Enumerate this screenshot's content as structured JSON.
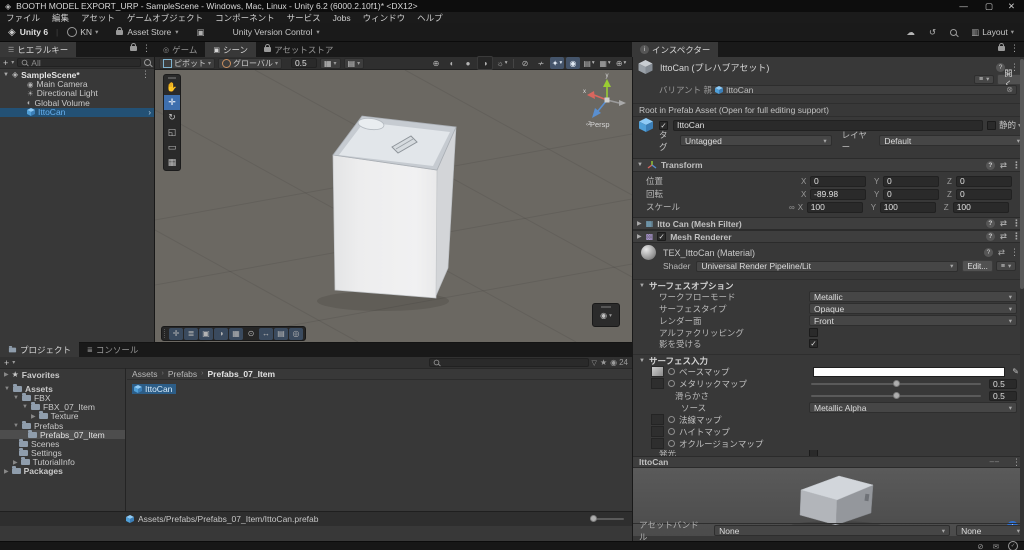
{
  "window": {
    "title": "BOOTH MODEL EXPORT_URP - SampleScene - Windows, Mac, Linux - Unity 6.2 (6000.2.10f1)* <DX12>",
    "menus": [
      "ファイル",
      "編集",
      "アセット",
      "ゲームオブジェクト",
      "コンポーネント",
      "サービス",
      "Jobs",
      "ウィンドウ",
      "ヘルプ"
    ]
  },
  "toolbar": {
    "brand": "Unity 6",
    "account": "KN",
    "asset_store": "Asset Store",
    "version_control": "Unity Version Control",
    "layout": "Layout"
  },
  "hierarchy": {
    "tab": "ヒエラルキー",
    "search_value": "All",
    "scene_name": "SampleScene*",
    "items": [
      "Main Camera",
      "Directional Light",
      "Global Volume",
      "IttoCan"
    ]
  },
  "scene": {
    "tab_game": "ゲーム",
    "tab_scene": "シーン",
    "tab_store": "アセットストア",
    "pivot_label": "ピボット",
    "global_label": "グローバル",
    "snap_value": "0.5",
    "persp_label": "Persp",
    "axis_x": "x",
    "axis_y": "y",
    "axis_z": "z"
  },
  "inspector": {
    "tab": "インスペクター",
    "prefab_title": "IttoCan (プレハブアセット)",
    "open_button": "開く",
    "variant_label": "バリアント 親",
    "variant_value": "IttoCan",
    "root_note": "Root in Prefab Asset (Open for full editing support)",
    "go": {
      "name": "IttoCan",
      "static_label": "静的",
      "tag_label": "タグ",
      "tag_value": "Untagged",
      "layer_label": "レイヤー",
      "layer_value": "Default"
    },
    "transform": {
      "title": "Transform",
      "axis": {
        "x": "X",
        "y": "Y",
        "z": "Z"
      },
      "position": {
        "label": "位置",
        "x": "0",
        "y": "0",
        "z": "0"
      },
      "rotation": {
        "label": "回転",
        "x": "-89.98",
        "y": "0",
        "z": "0"
      },
      "scale": {
        "label": "スケール",
        "x": "100",
        "y": "100",
        "z": "100"
      }
    },
    "mesh_filter_title": "Itto Can (Mesh Filter)",
    "mesh_renderer_title": "Mesh Renderer",
    "material": {
      "title": "TEX_IttoCan (Material)",
      "shader_label": "Shader",
      "shader_value": "Universal Render Pipeline/Lit",
      "edit_button": "Edit..."
    },
    "surface_options": {
      "title": "サーフェスオプション",
      "workflow_label": "ワークフローモード",
      "workflow_value": "Metallic",
      "surface_type_label": "サーフェスタイプ",
      "surface_type_value": "Opaque",
      "render_face_label": "レンダー面",
      "render_face_value": "Front",
      "alpha_clip_label": "アルファクリッピング",
      "receive_shadows_label": "影を受ける"
    },
    "surface_inputs": {
      "title": "サーフェス入力",
      "base_map_label": "ベースマップ",
      "metallic_map_label": "メタリックマップ",
      "metallic_value": "0.5",
      "smoothness_label": "滑らかさ",
      "smoothness_value": "0.5",
      "source_label": "ソース",
      "source_value": "Metallic Alpha",
      "normal_map_label": "法線マップ",
      "height_map_label": "ハイトマップ",
      "occlusion_map_label": "オクルージョンマップ",
      "emission_label": "発光"
    },
    "preview_title": "IttoCan",
    "asset_bundle": {
      "label": "アセットバンドル",
      "bundle_value": "None",
      "variant_value": "None"
    }
  },
  "project": {
    "tab_project": "プロジェクト",
    "tab_console": "コンソール",
    "favorites_label": "Favorites",
    "tree": [
      {
        "label": "Assets",
        "arrow": "▼"
      },
      {
        "label": "FBX",
        "arrow": "▼"
      },
      {
        "label": "FBX_07_Item",
        "arrow": "▼"
      },
      {
        "label": "Texture",
        "arrow": "▶"
      },
      {
        "label": "Prefabs",
        "arrow": "▼"
      },
      {
        "label": "Prefabs_07_Item",
        "arrow": ""
      },
      {
        "label": "Scenes",
        "arrow": ""
      },
      {
        "label": "Settings",
        "arrow": ""
      },
      {
        "label": "TutorialInfo",
        "arrow": "▶"
      },
      {
        "label": "Packages",
        "arrow": "▶"
      }
    ],
    "breadcrumb": [
      "Assets",
      "Prefabs",
      "Prefabs_07_Item"
    ],
    "selected_item": "IttoCan",
    "hidden_count": "24",
    "footer_path": "Assets/Prefabs/Prefabs_07_Item/IttoCan.prefab"
  },
  "colors": {
    "selection_blue": "#2c5d87",
    "hierarchy_selection": "#235175",
    "prefab_text_blue": "#66b1f0",
    "scene_background": "#6b6862",
    "base_map_swatch": "#ffffff",
    "accent_tool_blue": "#3e6fae"
  }
}
